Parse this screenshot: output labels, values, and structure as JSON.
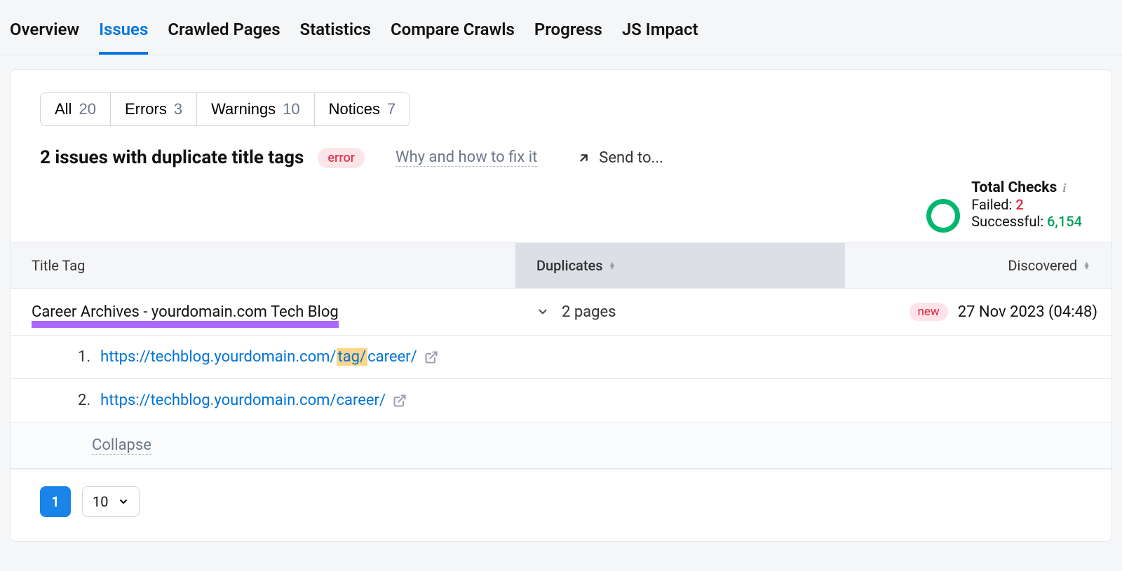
{
  "topnav": {
    "items": [
      "Overview",
      "Issues",
      "Crawled Pages",
      "Statistics",
      "Compare Crawls",
      "Progress",
      "JS Impact"
    ],
    "active_index": 1
  },
  "filters": [
    {
      "label": "All",
      "count": "20"
    },
    {
      "label": "Errors",
      "count": "3"
    },
    {
      "label": "Warnings",
      "count": "10"
    },
    {
      "label": "Notices",
      "count": "7"
    }
  ],
  "issue": {
    "title": "2 issues with duplicate title tags",
    "severity": "error",
    "whyfix": "Why and how to fix it",
    "sendto": "Send to..."
  },
  "checks": {
    "label": "Total Checks",
    "failed_label": "Failed:",
    "failed": "2",
    "successful_label": "Successful:",
    "successful": "6,154"
  },
  "columns": {
    "title": "Title Tag",
    "duplicates": "Duplicates",
    "discovered": "Discovered"
  },
  "row": {
    "title_tag": "Career Archives - yourdomain.com Tech Blog",
    "duplicates": "2 pages",
    "new_badge": "new",
    "discovered": "27 Nov 2023 (04:48)"
  },
  "urls": {
    "u1_num": "1.",
    "u1_pre": "https://techblog.yourdomain.com/",
    "u1_hl": "tag/",
    "u1_post": "career/",
    "u2_num": "2.",
    "u2": "https://techblog.yourdomain.com/career/"
  },
  "collapse": "Collapse",
  "pager": {
    "current": "1",
    "page_size": "10"
  }
}
